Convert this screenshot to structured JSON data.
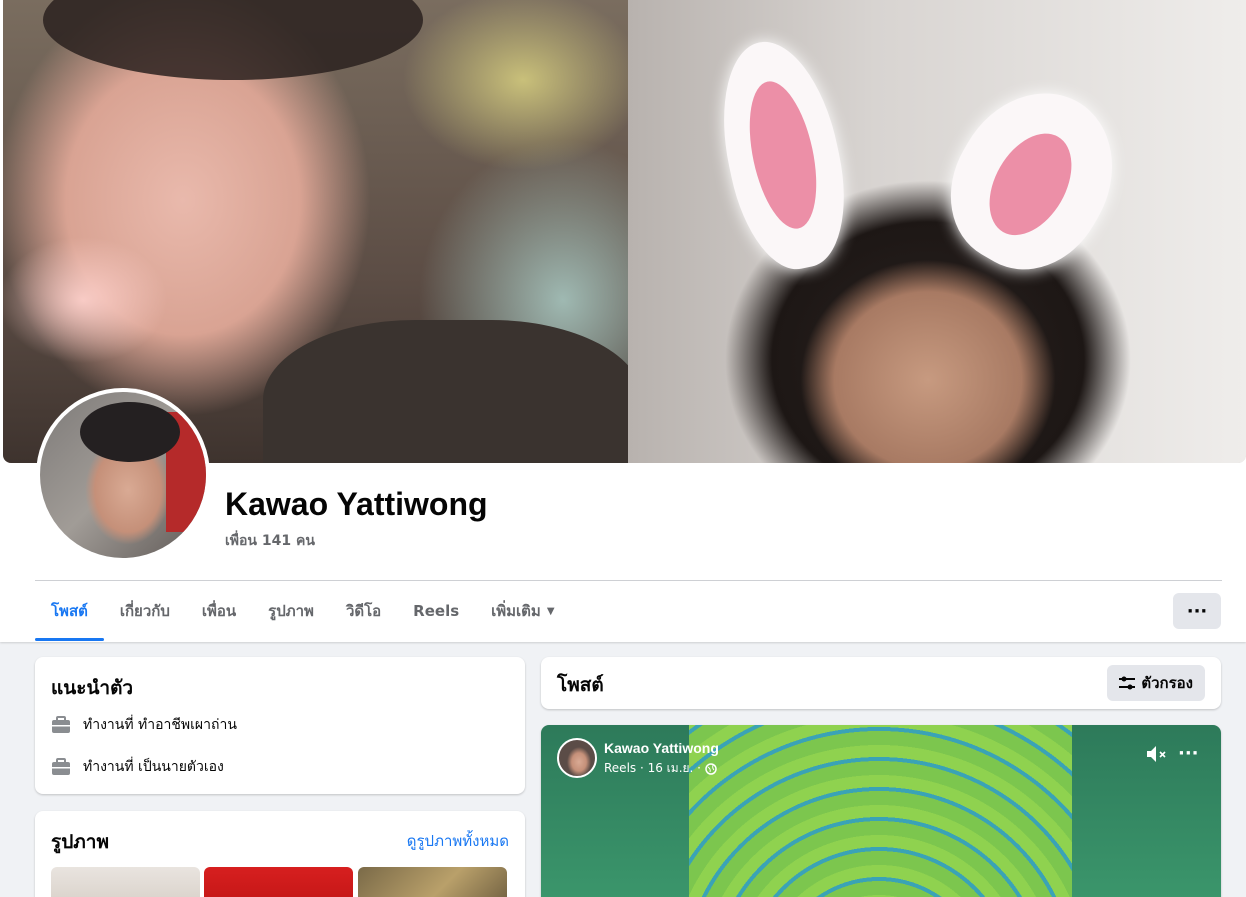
{
  "profile": {
    "name": "Kawao Yattiwong",
    "friends": "เพื่อน 141 คน"
  },
  "tabs": [
    {
      "label": "โพสต์",
      "active": true
    },
    {
      "label": "เกี่ยวกับ"
    },
    {
      "label": "เพื่อน"
    },
    {
      "label": "รูปภาพ"
    },
    {
      "label": "วิดีโอ"
    },
    {
      "label": "Reels"
    },
    {
      "label": "เพิ่มเติม"
    }
  ],
  "more_menu_label": "···",
  "intro": {
    "title": "แนะนำตัว",
    "items": [
      {
        "text": "ทำงานที่ ทำอาชีพเผาถ่าน",
        "icon": "briefcase-icon"
      },
      {
        "text": "ทำงานที่ เป็นนายตัวเอง",
        "icon": "briefcase-icon"
      }
    ]
  },
  "photos": {
    "title": "รูปภาพ",
    "see_all": "ดูรูปภาพทั้งหมด"
  },
  "posts": {
    "title": "โพสต์",
    "filter_label": "ตัวกรอง"
  },
  "reel_post": {
    "author": "Kawao Yattiwong",
    "meta": "Reels · 16 เม.ย. ·",
    "more_label": "···"
  },
  "colors": {
    "accent": "#1877f2",
    "background": "#f0f2f5",
    "secondary_text": "#65676b",
    "button_gray": "#e4e6eb"
  }
}
